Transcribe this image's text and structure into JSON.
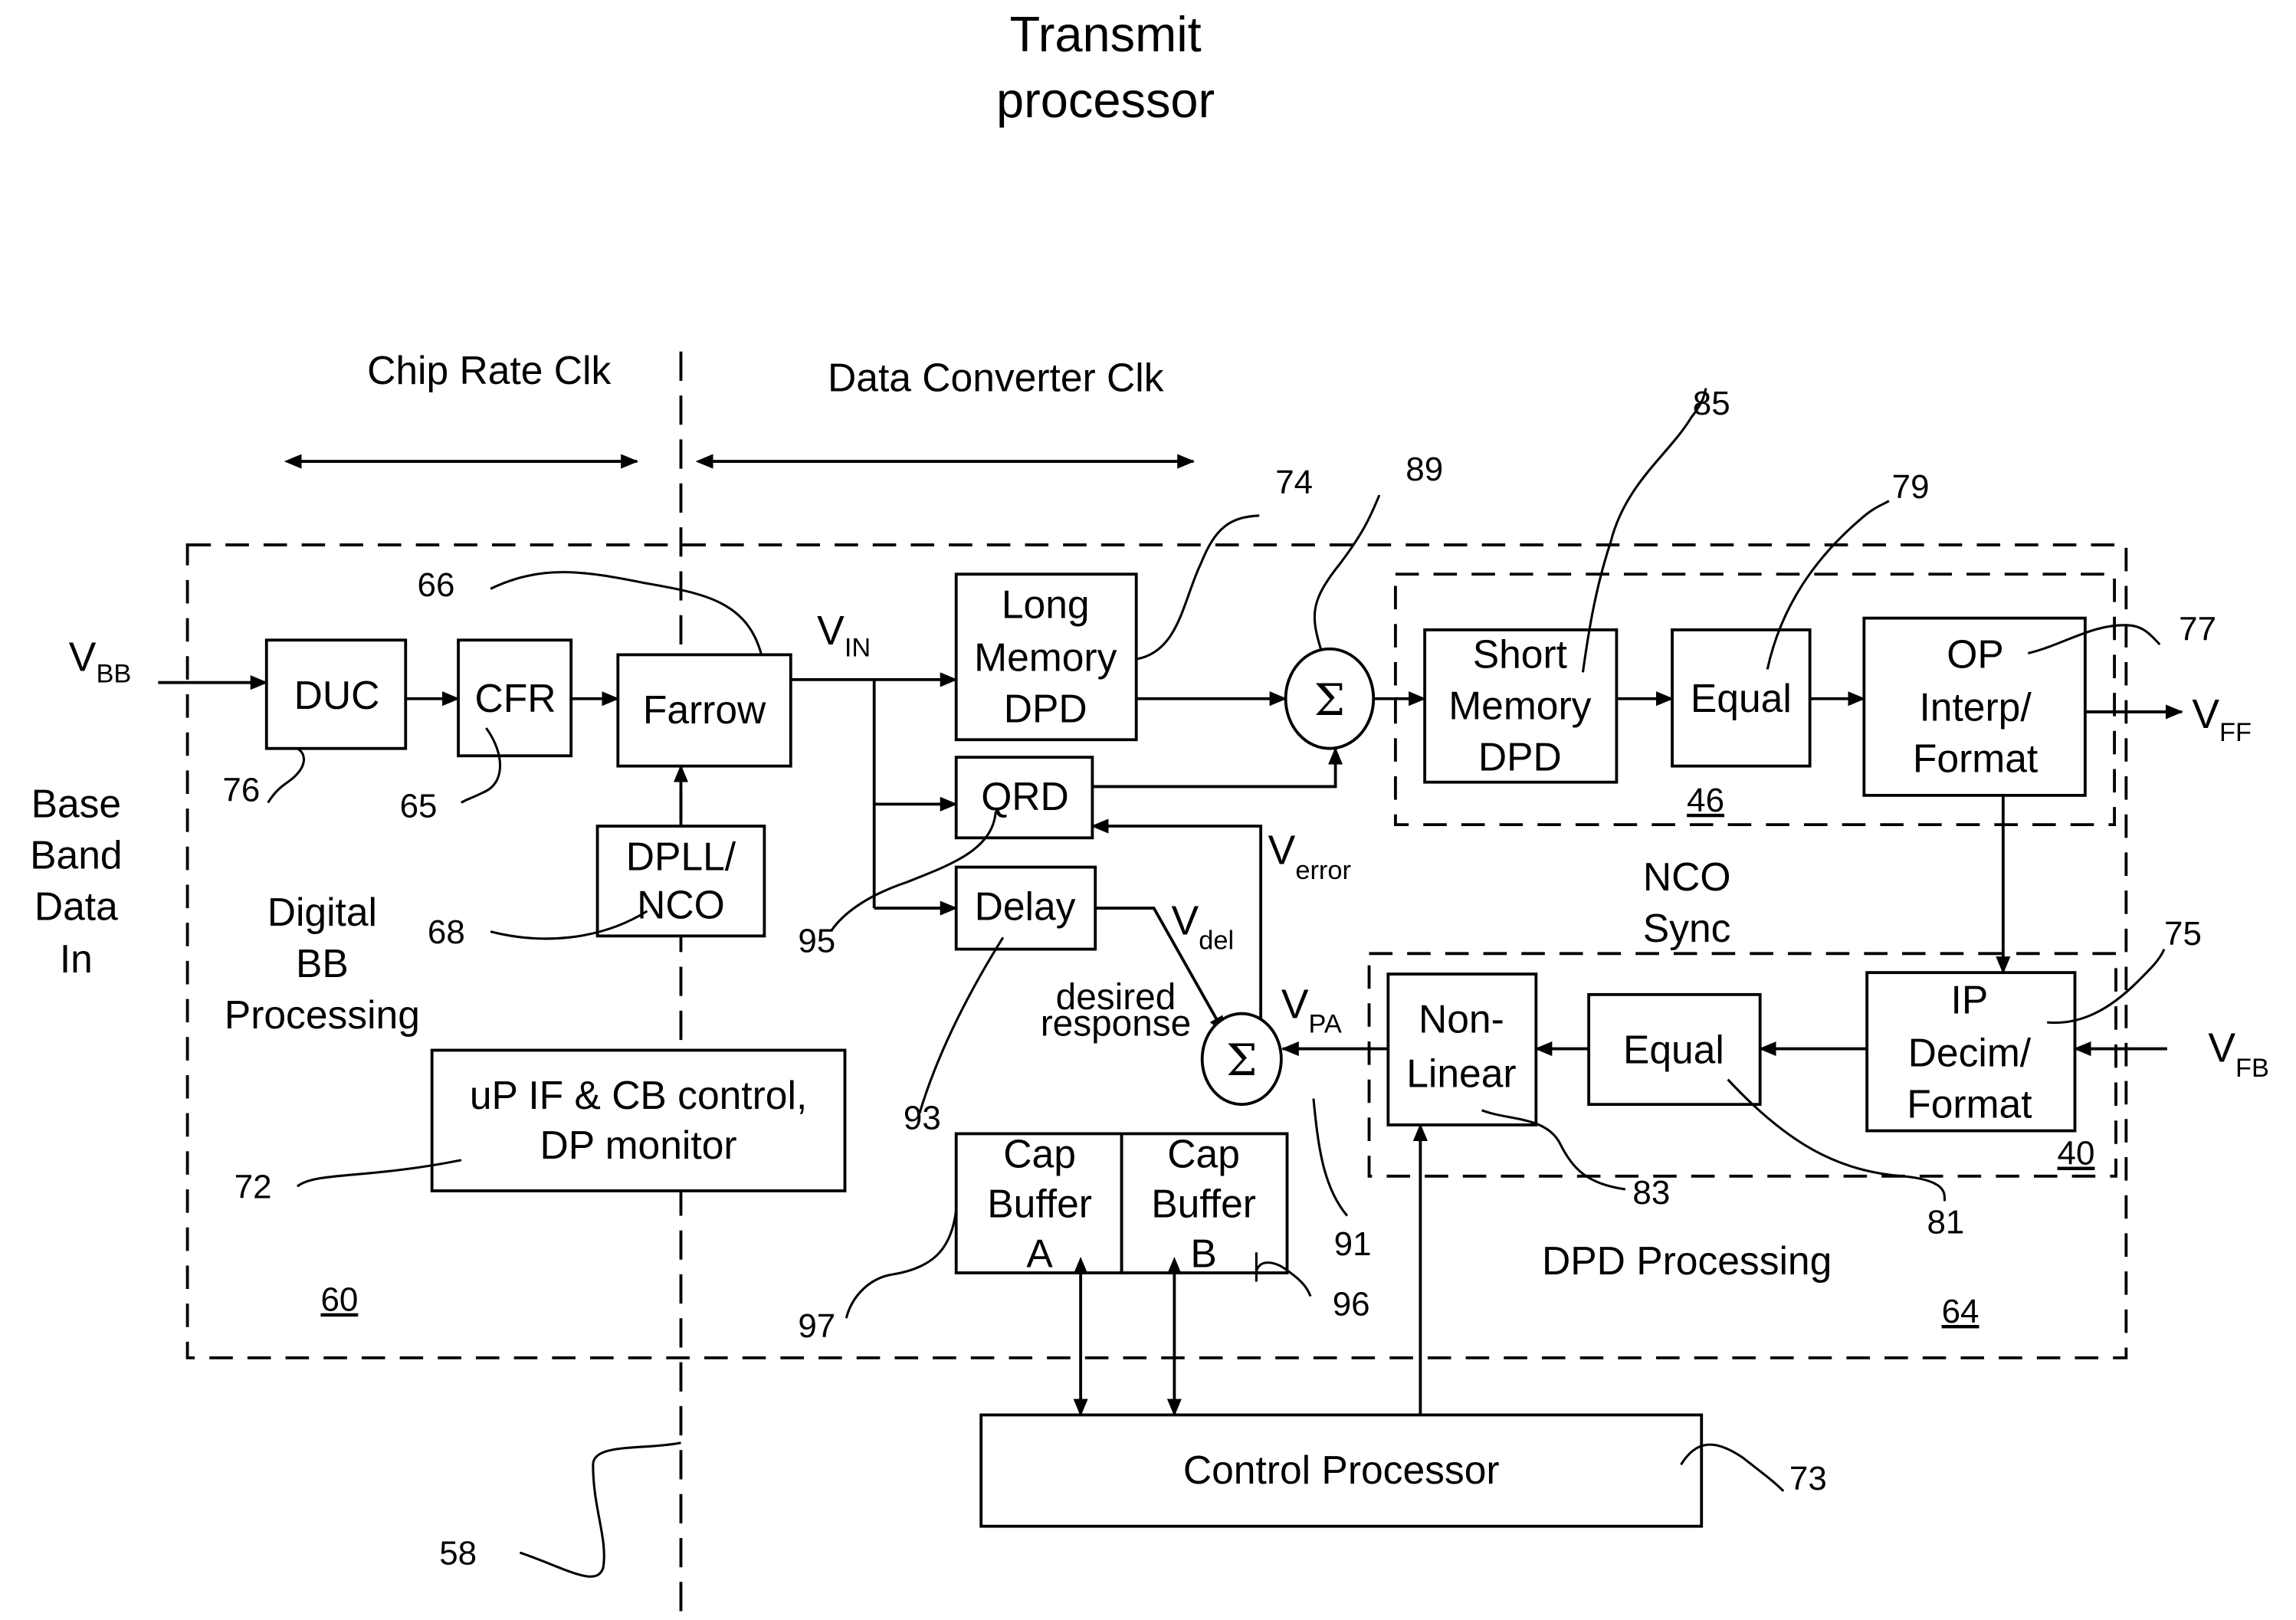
{
  "title": {
    "line1": "Transmit",
    "line2": "processor"
  },
  "clock_domains": {
    "left": "Chip Rate Clk",
    "right": "Data Converter Clk"
  },
  "left_label": {
    "line1": "Base",
    "line2": "Band",
    "line3": "Data",
    "line4": "In"
  },
  "signals": {
    "v_bb": {
      "main": "V",
      "sub": "BB"
    },
    "v_in": {
      "main": "V",
      "sub": "IN"
    },
    "v_ff": {
      "main": "V",
      "sub": "FF"
    },
    "v_fb": {
      "main": "V",
      "sub": "FB"
    },
    "v_error": {
      "main": "V",
      "sub": "error"
    },
    "v_del": {
      "main": "V",
      "sub": "del"
    },
    "v_pa": {
      "main": "V",
      "sub": "PA"
    },
    "desired_response": {
      "line1": "desired",
      "line2": "response"
    }
  },
  "regions": {
    "digital_bb": {
      "line1": "Digital",
      "line2": "BB",
      "line3": "Processing",
      "ref": "60"
    },
    "dpd": {
      "label": "DPD Processing",
      "ref": "64"
    },
    "forward_group": {
      "ref": "46"
    },
    "feedback_group": {
      "ref": "40"
    },
    "nco_sync": {
      "line1": "NCO",
      "line2": "Sync"
    }
  },
  "blocks": {
    "duc": {
      "label": "DUC",
      "ref": "76"
    },
    "cfr": {
      "label": "CFR",
      "ref": "65"
    },
    "farrow": {
      "label": "Farrow",
      "ref": "66"
    },
    "dpll": {
      "line1": "DPLL/",
      "line2": "NCO",
      "ref": "68"
    },
    "up_if": {
      "line1": "uP IF & CB control,",
      "line2": "DP monitor",
      "ref": "72"
    },
    "long_mem": {
      "line1": "Long",
      "line2": "Memory",
      "line3": "DPD",
      "ref": "74"
    },
    "qrd": {
      "label": "QRD",
      "ref": "95"
    },
    "delay": {
      "label": "Delay",
      "ref": "93"
    },
    "sum_top": {
      "symbol": "Σ",
      "ref": "89"
    },
    "sum_bottom": {
      "symbol": "Σ",
      "ref": "91"
    },
    "short_mem": {
      "line1": "Short",
      "line2": "Memory",
      "line3": "DPD",
      "ref": "85"
    },
    "equal_fwd": {
      "label": "Equal",
      "ref": "79"
    },
    "op_interp": {
      "line1": "OP",
      "line2": "Interp/",
      "line3": "Format",
      "ref": "77"
    },
    "ip_decim": {
      "line1": "IP",
      "line2": "Decim/",
      "line3": "Format",
      "ref": "75"
    },
    "equal_fb": {
      "label": "Equal",
      "ref": "81"
    },
    "nonlinear": {
      "line1": "Non-",
      "line2": "Linear",
      "ref": "83"
    },
    "cap_a": {
      "line1": "Cap",
      "line2": "Buffer",
      "line3": "A",
      "ref": "97"
    },
    "cap_b": {
      "line1": "Cap",
      "line2": "Buffer",
      "line3": "B",
      "ref": "96"
    },
    "control": {
      "label": "Control Processor",
      "ref": "73"
    }
  },
  "boundary": {
    "ref": "58"
  }
}
